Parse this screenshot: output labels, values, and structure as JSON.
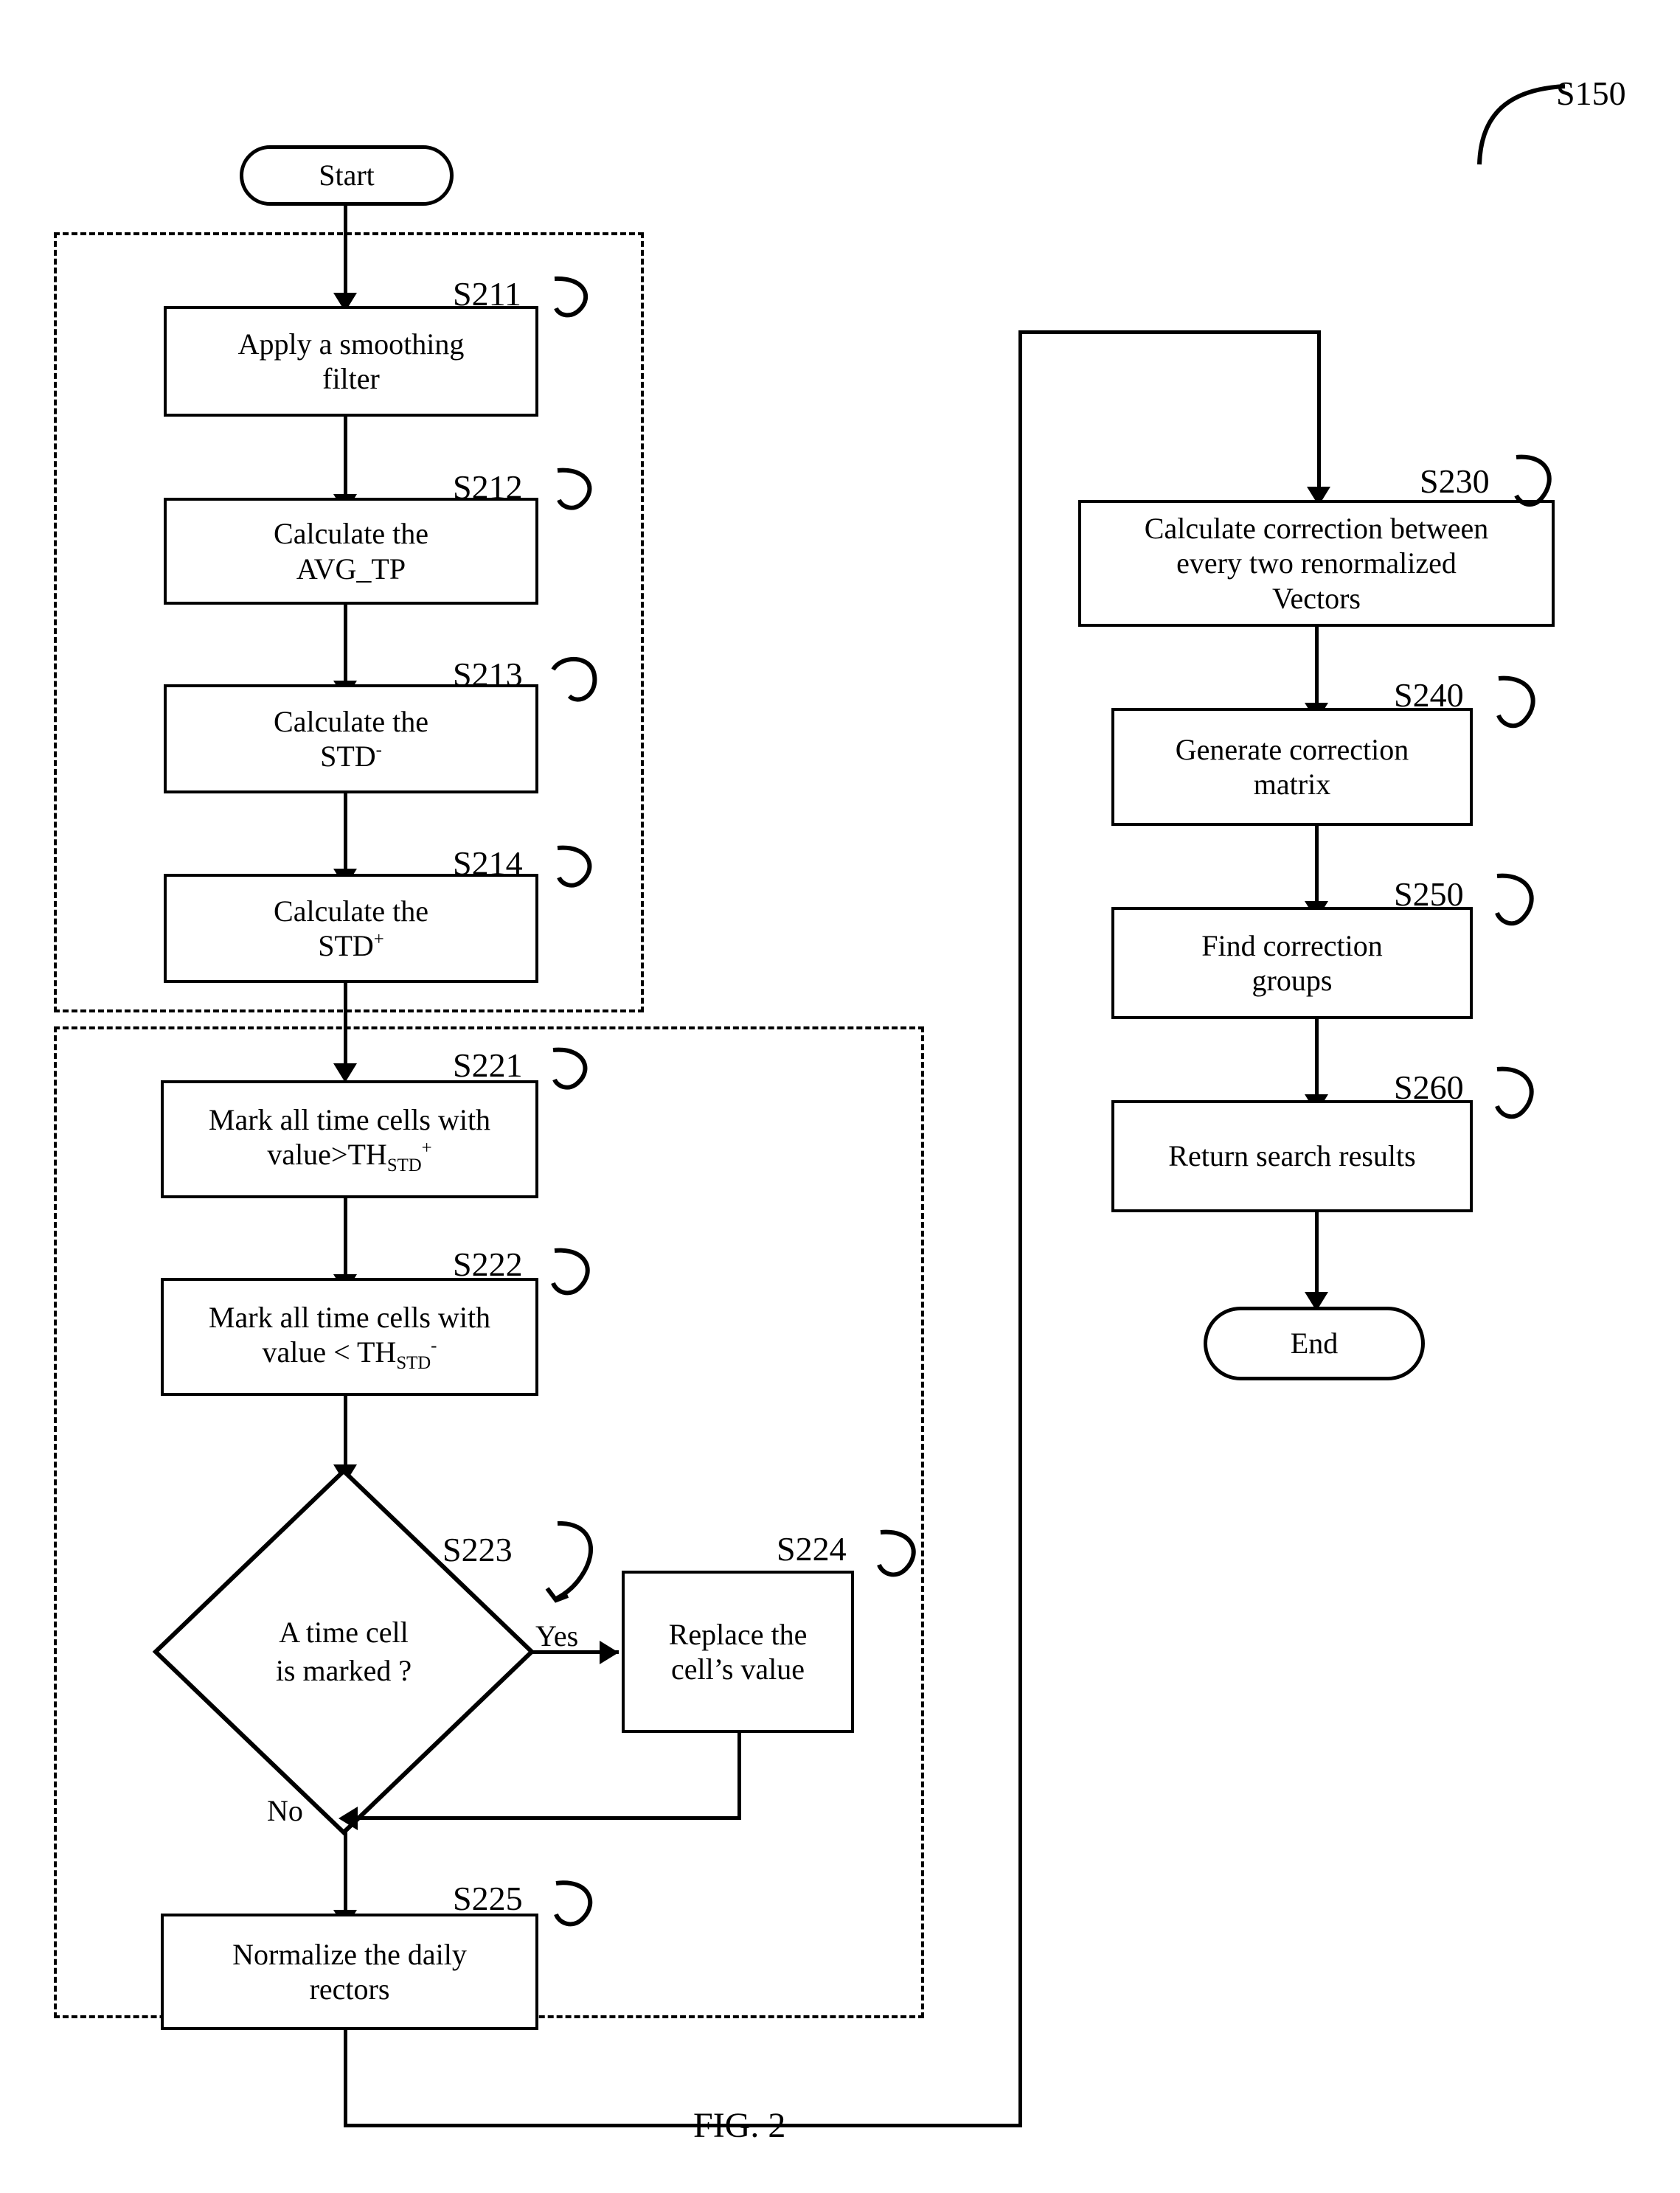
{
  "figure": {
    "caption": "FIG. 2",
    "overall_label": "S150"
  },
  "nodes": {
    "start": {
      "id": "start",
      "label": "Start",
      "shape": "terminator"
    },
    "end": {
      "id": "end",
      "label": "End",
      "shape": "terminator"
    },
    "s211": {
      "step": "S211",
      "label": "Apply a smoothing\nfilter",
      "shape": "process"
    },
    "s212": {
      "step": "S212",
      "label": "Calculate the\nAVG_TP",
      "shape": "process"
    },
    "s213": {
      "step": "S213",
      "label_pre": "Calculate the\nSTD",
      "sup": "-",
      "shape": "process"
    },
    "s214": {
      "step": "S214",
      "label_pre": "Calculate the\nSTD",
      "sup": "+",
      "shape": "process"
    },
    "s221": {
      "step": "S221",
      "line1": "Mark all time cells with",
      "line2_pre": "value>TH",
      "sub": "STD",
      "sup": "+",
      "shape": "process"
    },
    "s222": {
      "step": "S222",
      "line1": "Mark all time cells with",
      "line2_pre": "value < TH",
      "sub": "STD",
      "sup": "-",
      "shape": "process"
    },
    "s223": {
      "step": "S223",
      "label": "A time cell\nis marked ?",
      "shape": "decision"
    },
    "s224": {
      "step": "S224",
      "label": "Replace the\ncell’s value",
      "shape": "process"
    },
    "s225": {
      "step": "S225",
      "label": "Normalize the daily\nrectors",
      "shape": "process"
    },
    "s230": {
      "step": "S230",
      "label": "Calculate correction between\nevery two renormalized\nVectors",
      "shape": "process"
    },
    "s240": {
      "step": "S240",
      "label": "Generate correction\nmatrix",
      "shape": "process"
    },
    "s250": {
      "step": "S250",
      "label": "Find correction\ngroups",
      "shape": "process"
    },
    "s260": {
      "step": "S260",
      "label": "Return search results",
      "shape": "process"
    }
  },
  "edge_labels": {
    "yes": "Yes",
    "no": "No"
  },
  "colors": {
    "stroke": "#000000",
    "background": "#ffffff"
  }
}
